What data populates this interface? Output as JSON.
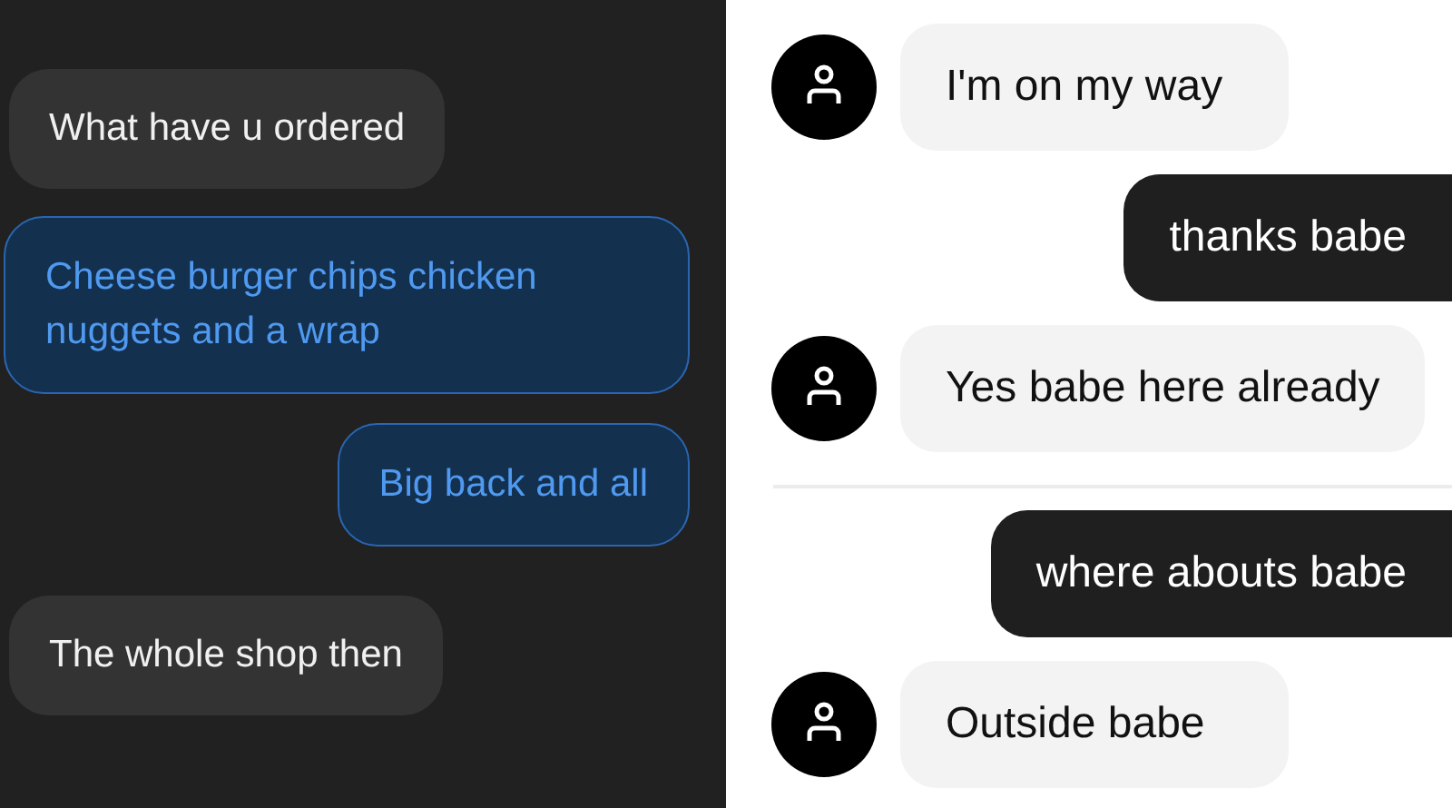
{
  "left_chat": {
    "messages": [
      {
        "text": "What have u ordered",
        "kind": "incoming"
      },
      {
        "text": "Cheese burger chips chicken nuggets and a wrap",
        "kind": "outgoing"
      },
      {
        "text": "Big back and all",
        "kind": "outgoing"
      },
      {
        "text": "The whole shop then",
        "kind": "incoming"
      }
    ]
  },
  "right_chat": {
    "messages": [
      {
        "text": "I'm on my way",
        "kind": "incoming"
      },
      {
        "text": "thanks babe",
        "kind": "outgoing"
      },
      {
        "text": "Yes babe here already",
        "kind": "incoming"
      },
      {
        "text": "where abouts babe",
        "kind": "outgoing"
      },
      {
        "text": "Outside babe",
        "kind": "incoming"
      }
    ]
  }
}
